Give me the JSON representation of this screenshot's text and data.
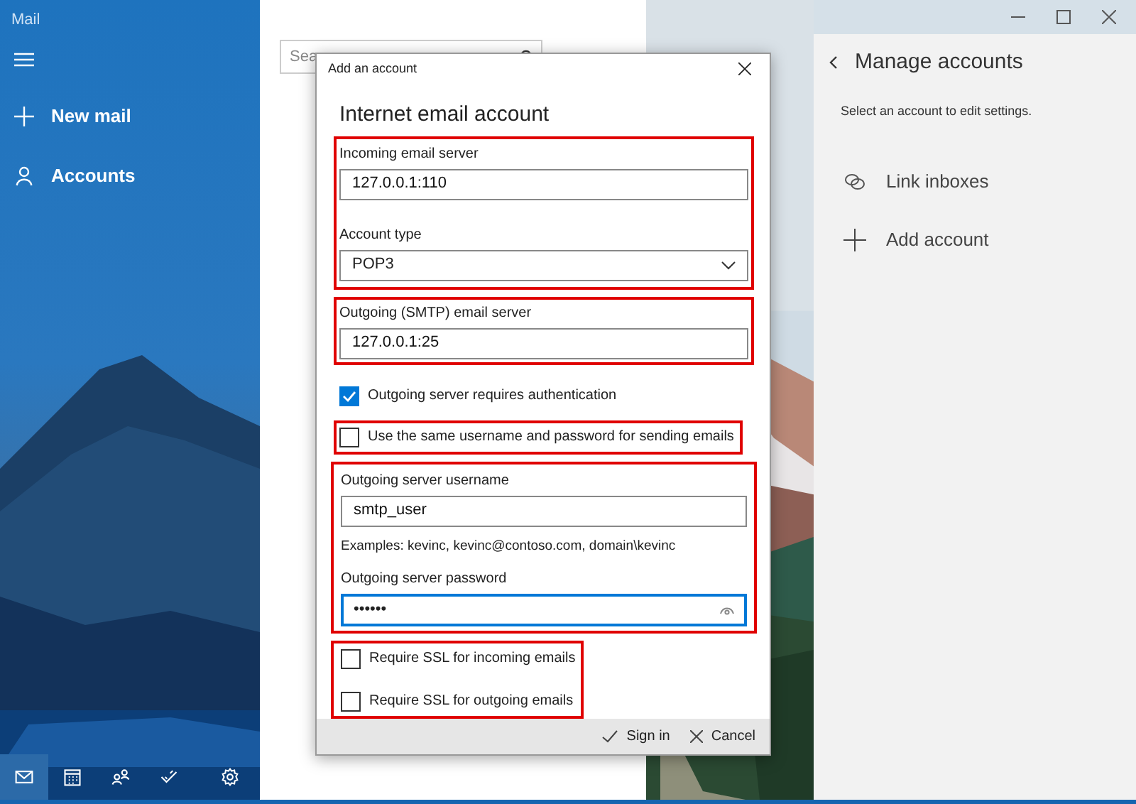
{
  "app": {
    "title": "Mail"
  },
  "sidebar": {
    "items": [
      {
        "kind": "new",
        "label": "New mail"
      },
      {
        "kind": "accounts",
        "label": "Accounts"
      }
    ],
    "bottom_nav": [
      {
        "kind": "mail",
        "selected": true
      },
      {
        "kind": "calendar",
        "selected": false
      },
      {
        "kind": "people",
        "selected": false
      },
      {
        "kind": "todo",
        "selected": false
      },
      {
        "kind": "settings",
        "selected": false
      }
    ]
  },
  "search": {
    "placeholder": "Sea"
  },
  "dialog": {
    "title": "Add an account",
    "heading": "Internet email account",
    "incoming_server": {
      "label": "Incoming email server",
      "value": "127.0.0.1:110"
    },
    "account_type": {
      "label": "Account type",
      "value": "POP3"
    },
    "outgoing_server": {
      "label": "Outgoing (SMTP) email server",
      "value": "127.0.0.1:25"
    },
    "auth": {
      "label": "Outgoing server requires authentication",
      "checked": true
    },
    "same_credentials": {
      "label": "Use the same username and password for sending emails",
      "checked": false
    },
    "username": {
      "label": "Outgoing server username",
      "value": "smtp_user",
      "hint": "Examples: kevinc, kevinc@contoso.com, domain\\kevinc"
    },
    "password": {
      "label": "Outgoing server password",
      "value": "••••••"
    },
    "ssl": [
      {
        "label": "Require SSL for incoming emails",
        "checked": false
      },
      {
        "label": "Require SSL for outgoing emails",
        "checked": false
      }
    ],
    "buttons": [
      {
        "kind": "confirm",
        "label": "Sign in"
      },
      {
        "kind": "cancel",
        "label": "Cancel"
      }
    ]
  },
  "manage_accounts": {
    "title": "Manage accounts",
    "subtitle": "Select an account to edit settings.",
    "items": [
      {
        "kind": "link",
        "label": "Link inboxes"
      },
      {
        "kind": "add",
        "label": "Add account"
      }
    ]
  }
}
